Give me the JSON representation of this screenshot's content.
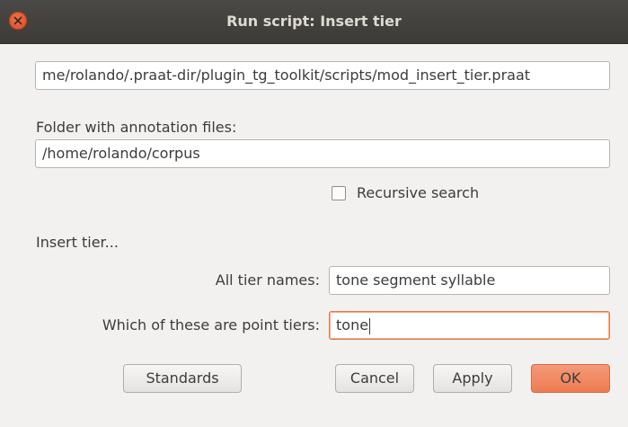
{
  "window": {
    "title": "Run script: Insert tier"
  },
  "script_path": {
    "value": "me/rolando/.praat-dir/plugin_tg_toolkit/scripts/mod_insert_tier.praat"
  },
  "folder": {
    "label": "Folder with annotation files:",
    "value": "/home/rolando/corpus"
  },
  "recursive": {
    "label": "Recursive search",
    "checked": false
  },
  "section": {
    "label": "Insert tier..."
  },
  "tier_names": {
    "label": "All tier names:",
    "value": "tone segment syllable"
  },
  "point_tiers": {
    "label": "Which of these are point tiers:",
    "value": "tone"
  },
  "buttons": {
    "standards": "Standards",
    "cancel": "Cancel",
    "apply": "Apply",
    "ok": "OK"
  },
  "colors": {
    "ok_accent": "#ee7c53",
    "close_button": "#e95420",
    "focus_border": "#e8763d"
  },
  "icons": {
    "close": "close-icon"
  }
}
